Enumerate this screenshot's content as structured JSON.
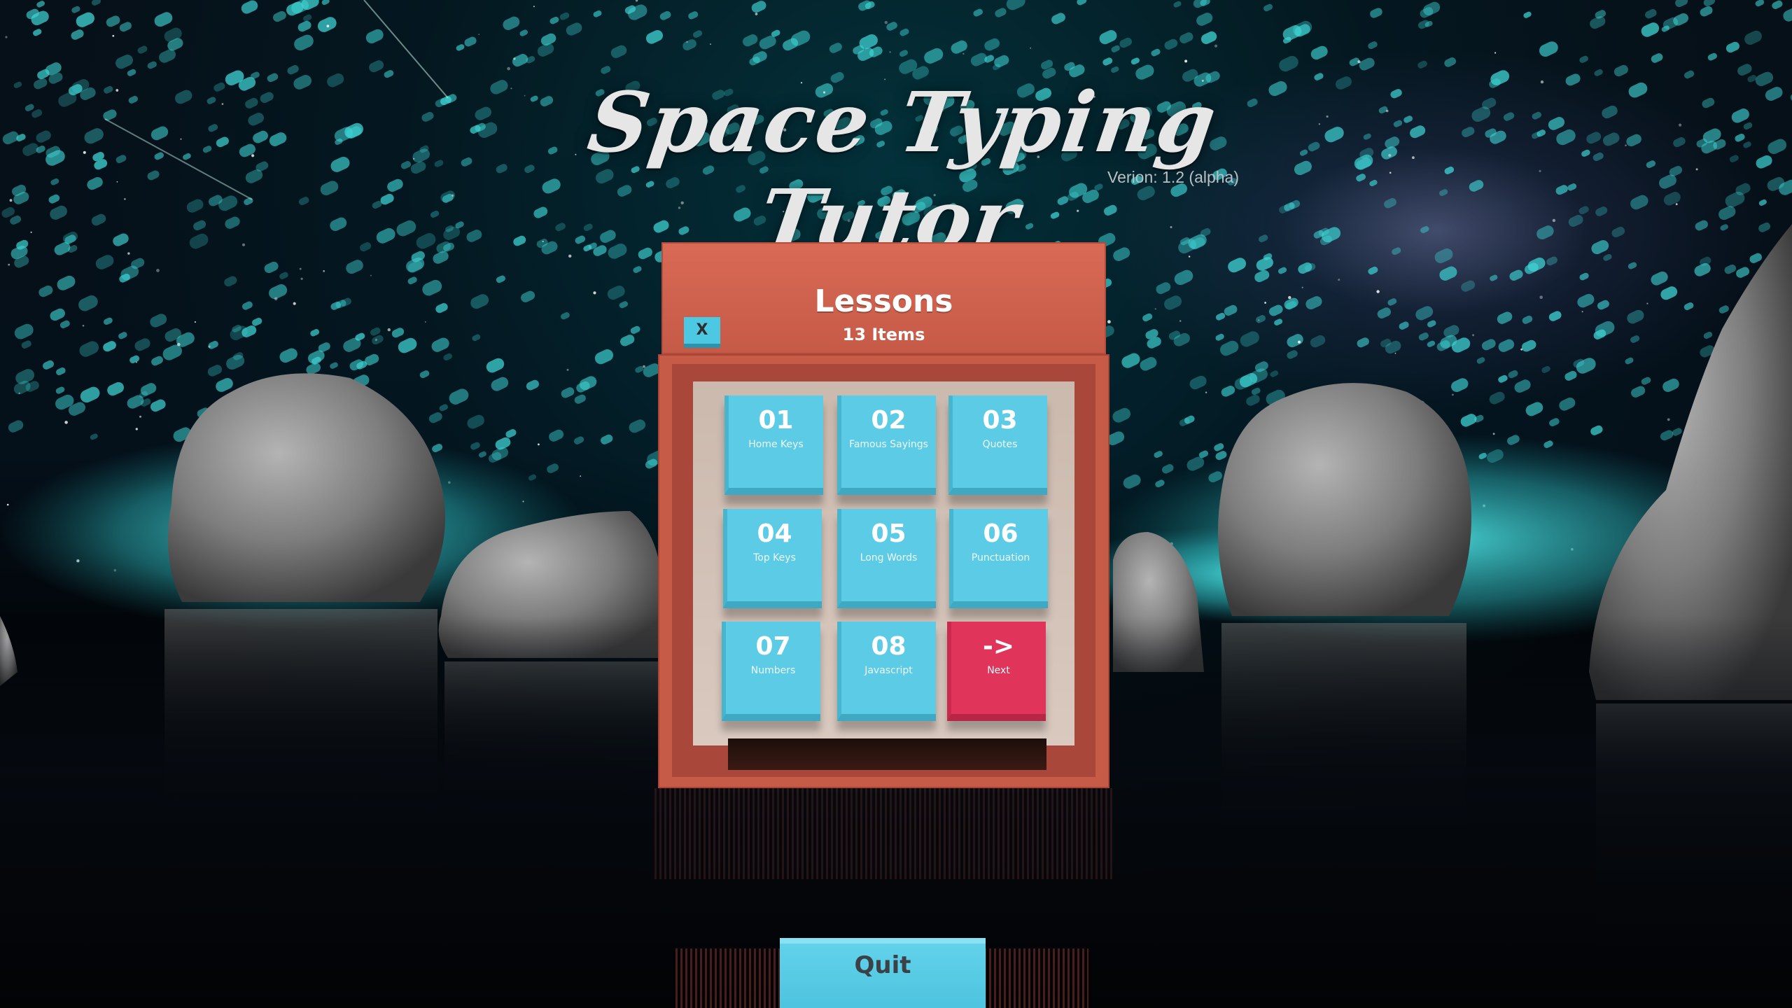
{
  "game": {
    "title": "Space Typing Tutor",
    "version": "Verion: 1.2 (alpha)"
  },
  "lessons_panel": {
    "title": "Lessons",
    "subtitle": "13 Items",
    "close_label": "X",
    "tiles": [
      {
        "number": "01",
        "label": "Home Keys",
        "accent": "#5ccbe6"
      },
      {
        "number": "02",
        "label": "Famous Sayings",
        "accent": "#5ccbe6"
      },
      {
        "number": "03",
        "label": "Quotes",
        "accent": "#5ccbe6"
      },
      {
        "number": "04",
        "label": "Top Keys",
        "accent": "#5ccbe6"
      },
      {
        "number": "05",
        "label": "Long Words",
        "accent": "#5ccbe6"
      },
      {
        "number": "06",
        "label": "Punctuation",
        "accent": "#5ccbe6"
      },
      {
        "number": "07",
        "label": "Numbers",
        "accent": "#5ccbe6"
      },
      {
        "number": "08",
        "label": "Javascript",
        "accent": "#5ccbe6"
      },
      {
        "number": "->",
        "label": "Next",
        "accent": "#e0345a"
      }
    ]
  },
  "footer": {
    "quit_label": "Quit"
  },
  "colors": {
    "panel": "#c65b48",
    "tile": "#5ccbe6",
    "next_tile": "#e0345a",
    "particles": "#3fd6d6"
  }
}
